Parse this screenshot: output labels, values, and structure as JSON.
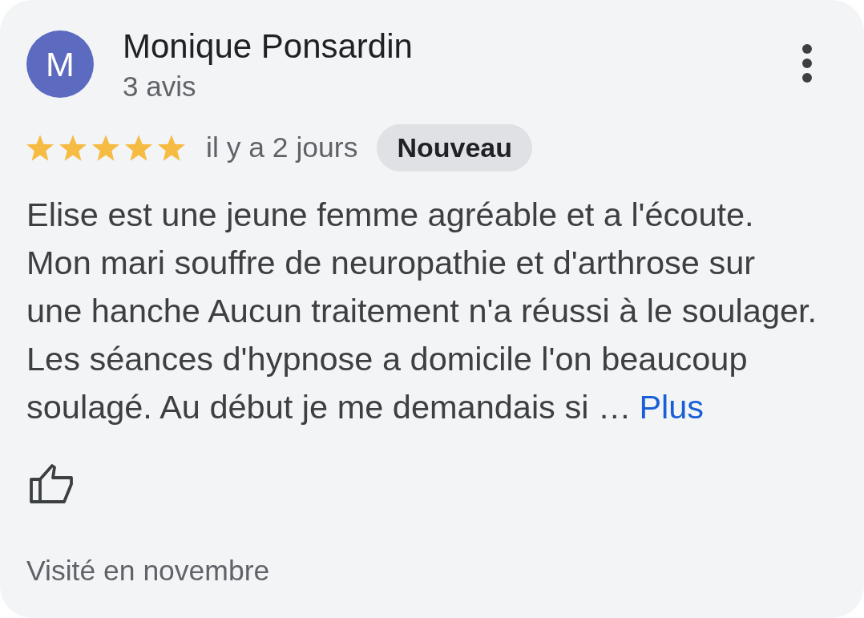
{
  "review": {
    "author": {
      "initial": "M",
      "name": "Monique Ponsardin",
      "review_count": "3 avis"
    },
    "stars": 5,
    "date": "il y a 2 jours",
    "badge": "Nouveau",
    "text": "Elise est une jeune femme agréable et a l'écoute.\nMon mari souffre de neuropathie et d'arthrose sur\nune hanche Aucun traitement n'a réussi à le soulager.\nLes séances d'hypnose a domicile l'on beaucoup\nsoulagé. Au début je me demandais si …",
    "more_link": "Plus",
    "visit": "Visité en novembre"
  }
}
